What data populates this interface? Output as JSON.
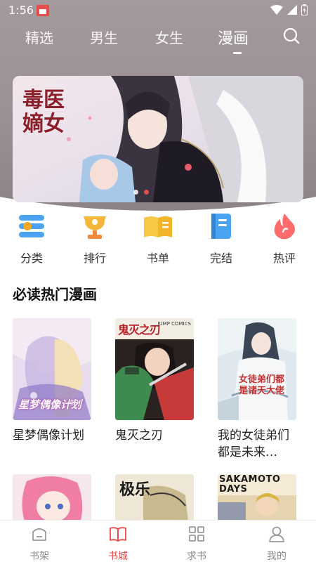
{
  "status": {
    "time": "1:56"
  },
  "tabs": [
    "精选",
    "男生",
    "女生",
    "漫画"
  ],
  "active_tab": "漫画",
  "banner": {
    "title_art": "毒医嫡女",
    "dots": 2,
    "active_dot": 1
  },
  "quick_nav": [
    {
      "label": "分类",
      "icon": "category-icon"
    },
    {
      "label": "排行",
      "icon": "trophy-icon"
    },
    {
      "label": "书单",
      "icon": "book-list-icon"
    },
    {
      "label": "完结",
      "icon": "finished-book-icon"
    },
    {
      "label": "热评",
      "icon": "flame-icon"
    }
  ],
  "section": {
    "title": "必读热门漫画"
  },
  "books": [
    {
      "title": "星梦偶像计划",
      "cover_text": "星梦偶像计划"
    },
    {
      "title": "鬼灭之刃",
      "cover_text": "鬼灭之刃"
    },
    {
      "title": "我的女徒弟们都是未来…",
      "cover_text": "女徒弟们都是诸天大佬"
    },
    {
      "title": "",
      "cover_text": ""
    },
    {
      "title": "",
      "cover_text": "极乐"
    },
    {
      "title": "",
      "cover_text": "SAKAMOTO DAYS"
    }
  ],
  "bottom_nav": [
    {
      "label": "书架",
      "icon": "shelf-icon"
    },
    {
      "label": "书城",
      "icon": "open-book-icon"
    },
    {
      "label": "求书",
      "icon": "grid-icon"
    },
    {
      "label": "我的",
      "icon": "user-icon"
    }
  ],
  "active_bottom": "书城",
  "colors": {
    "accent": "#e84b4b",
    "header": "#9d9496"
  }
}
